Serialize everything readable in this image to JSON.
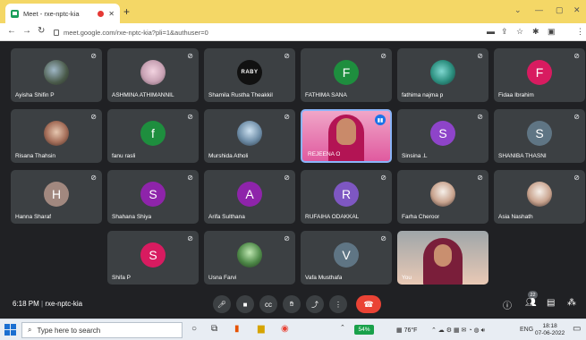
{
  "browser": {
    "tab_title": "Meet - rxe-nptc-kia",
    "url": "meet.google.com/rxe-nptc-kia?pli=1&authuser=0",
    "profile_initial": "M"
  },
  "tiles": [
    {
      "name": "Ayisha Shifin P",
      "avatar_letter": "",
      "avatar_color": "",
      "photo": "p1",
      "muted": true
    },
    {
      "name": "ASHMINA ATHIMANNIL",
      "avatar_letter": "",
      "avatar_color": "",
      "photo": "p2",
      "muted": true
    },
    {
      "name": "Shamila Rustha Theakkil",
      "avatar_letter": "RABY",
      "avatar_color": "#111111",
      "photo": "p3",
      "muted": true
    },
    {
      "name": "FATHIMA SANA",
      "avatar_letter": "F",
      "avatar_color": "#1e8e3e",
      "photo": "",
      "muted": true
    },
    {
      "name": "fathima najma p",
      "avatar_letter": "",
      "avatar_color": "",
      "photo": "p4",
      "muted": true
    },
    {
      "name": "Fidaa Ibrahim",
      "avatar_letter": "F",
      "avatar_color": "#d81b60",
      "photo": "",
      "muted": true
    },
    {
      "name": "Risana Thahsin",
      "avatar_letter": "",
      "avatar_color": "",
      "photo": "p5",
      "muted": true
    },
    {
      "name": "fanu rasli",
      "avatar_letter": "f",
      "avatar_color": "#1e8e3e",
      "photo": "",
      "muted": true
    },
    {
      "name": "Murshida Atholi",
      "avatar_letter": "",
      "avatar_color": "",
      "photo": "p6",
      "muted": true
    },
    {
      "name": "REJEENA O",
      "avatar_letter": "",
      "avatar_color": "",
      "photo": "cam",
      "muted": false
    },
    {
      "name": "Sinsina .L",
      "avatar_letter": "S",
      "avatar_color": "#8e44c9",
      "photo": "",
      "muted": true
    },
    {
      "name": "SHANIBA THASNI",
      "avatar_letter": "S",
      "avatar_color": "#5f7584",
      "photo": "",
      "muted": true
    },
    {
      "name": "Hanna Sharaf",
      "avatar_letter": "H",
      "avatar_color": "#a1887f",
      "photo": "",
      "muted": true
    },
    {
      "name": "Shahana Shiya",
      "avatar_letter": "S",
      "avatar_color": "#8e24aa",
      "photo": "",
      "muted": true
    },
    {
      "name": "Arifa Sulthana",
      "avatar_letter": "A",
      "avatar_color": "#8e24aa",
      "photo": "",
      "muted": true
    },
    {
      "name": "RUFAIHA ODAKKAL",
      "avatar_letter": "R",
      "avatar_color": "#7e57c2",
      "photo": "",
      "muted": true
    },
    {
      "name": "Farha Cheroor",
      "avatar_letter": "",
      "avatar_color": "",
      "photo": "p7",
      "muted": true
    },
    {
      "name": "Asia Nashath",
      "avatar_letter": "",
      "avatar_color": "",
      "photo": "p7",
      "muted": true
    },
    {
      "name": "Shifa P",
      "avatar_letter": "S",
      "avatar_color": "#d81b60",
      "photo": "",
      "muted": true
    },
    {
      "name": "Usna Farvi",
      "avatar_letter": "",
      "avatar_color": "",
      "photo": "p8",
      "muted": true
    },
    {
      "name": "Vafa Musthafa",
      "avatar_letter": "V",
      "avatar_color": "#5f7584",
      "photo": "",
      "muted": true
    },
    {
      "name": "You",
      "avatar_letter": "",
      "avatar_color": "",
      "photo": "you",
      "muted": false
    }
  ],
  "meeting": {
    "time": "6:18 PM",
    "code": "rxe-nptc-kia",
    "participants_count": "22"
  },
  "taskbar": {
    "search_placeholder": "Type here to search",
    "battery": "54%",
    "weather": "76°F",
    "lang": "ENG",
    "time": "18:18",
    "date": "07-06-2022"
  }
}
